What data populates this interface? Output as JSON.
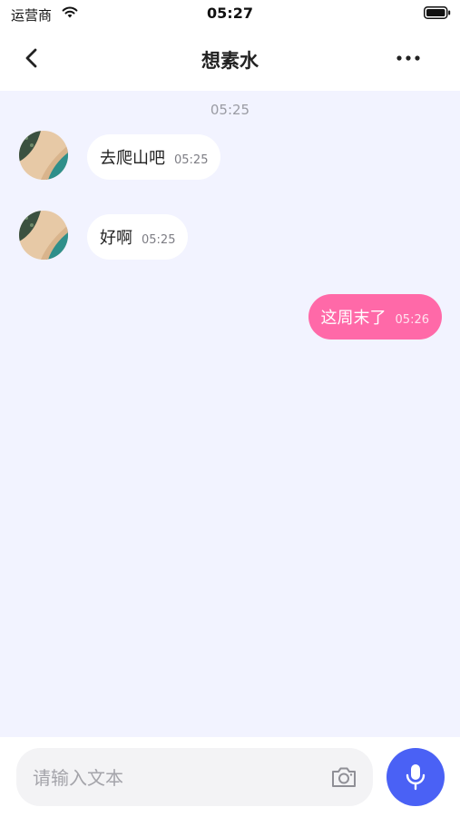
{
  "status_bar": {
    "carrier": "运营商",
    "time": "05:27",
    "wifi_icon": "wifi-icon",
    "battery_icon": "battery-icon"
  },
  "header": {
    "title": "想素水",
    "back_icon": "chevron-left-icon",
    "more_icon": "more-horizontal-icon"
  },
  "chat": {
    "time_separator": "05:25",
    "messages": [
      {
        "direction": "incoming",
        "text": "去爬山吧",
        "time": "05:25"
      },
      {
        "direction": "incoming",
        "text": "好啊",
        "time": "05:25"
      },
      {
        "direction": "outgoing",
        "text": "这周末了",
        "time": "05:26"
      }
    ]
  },
  "composer": {
    "placeholder": "请输入文本",
    "value": "",
    "camera_icon": "camera-icon",
    "mic_icon": "microphone-icon"
  },
  "colors": {
    "chat_background": "#f2f3ff",
    "outgoing_bubble": "#ff69a8",
    "incoming_bubble": "#ffffff",
    "accent": "#4a61f5"
  }
}
